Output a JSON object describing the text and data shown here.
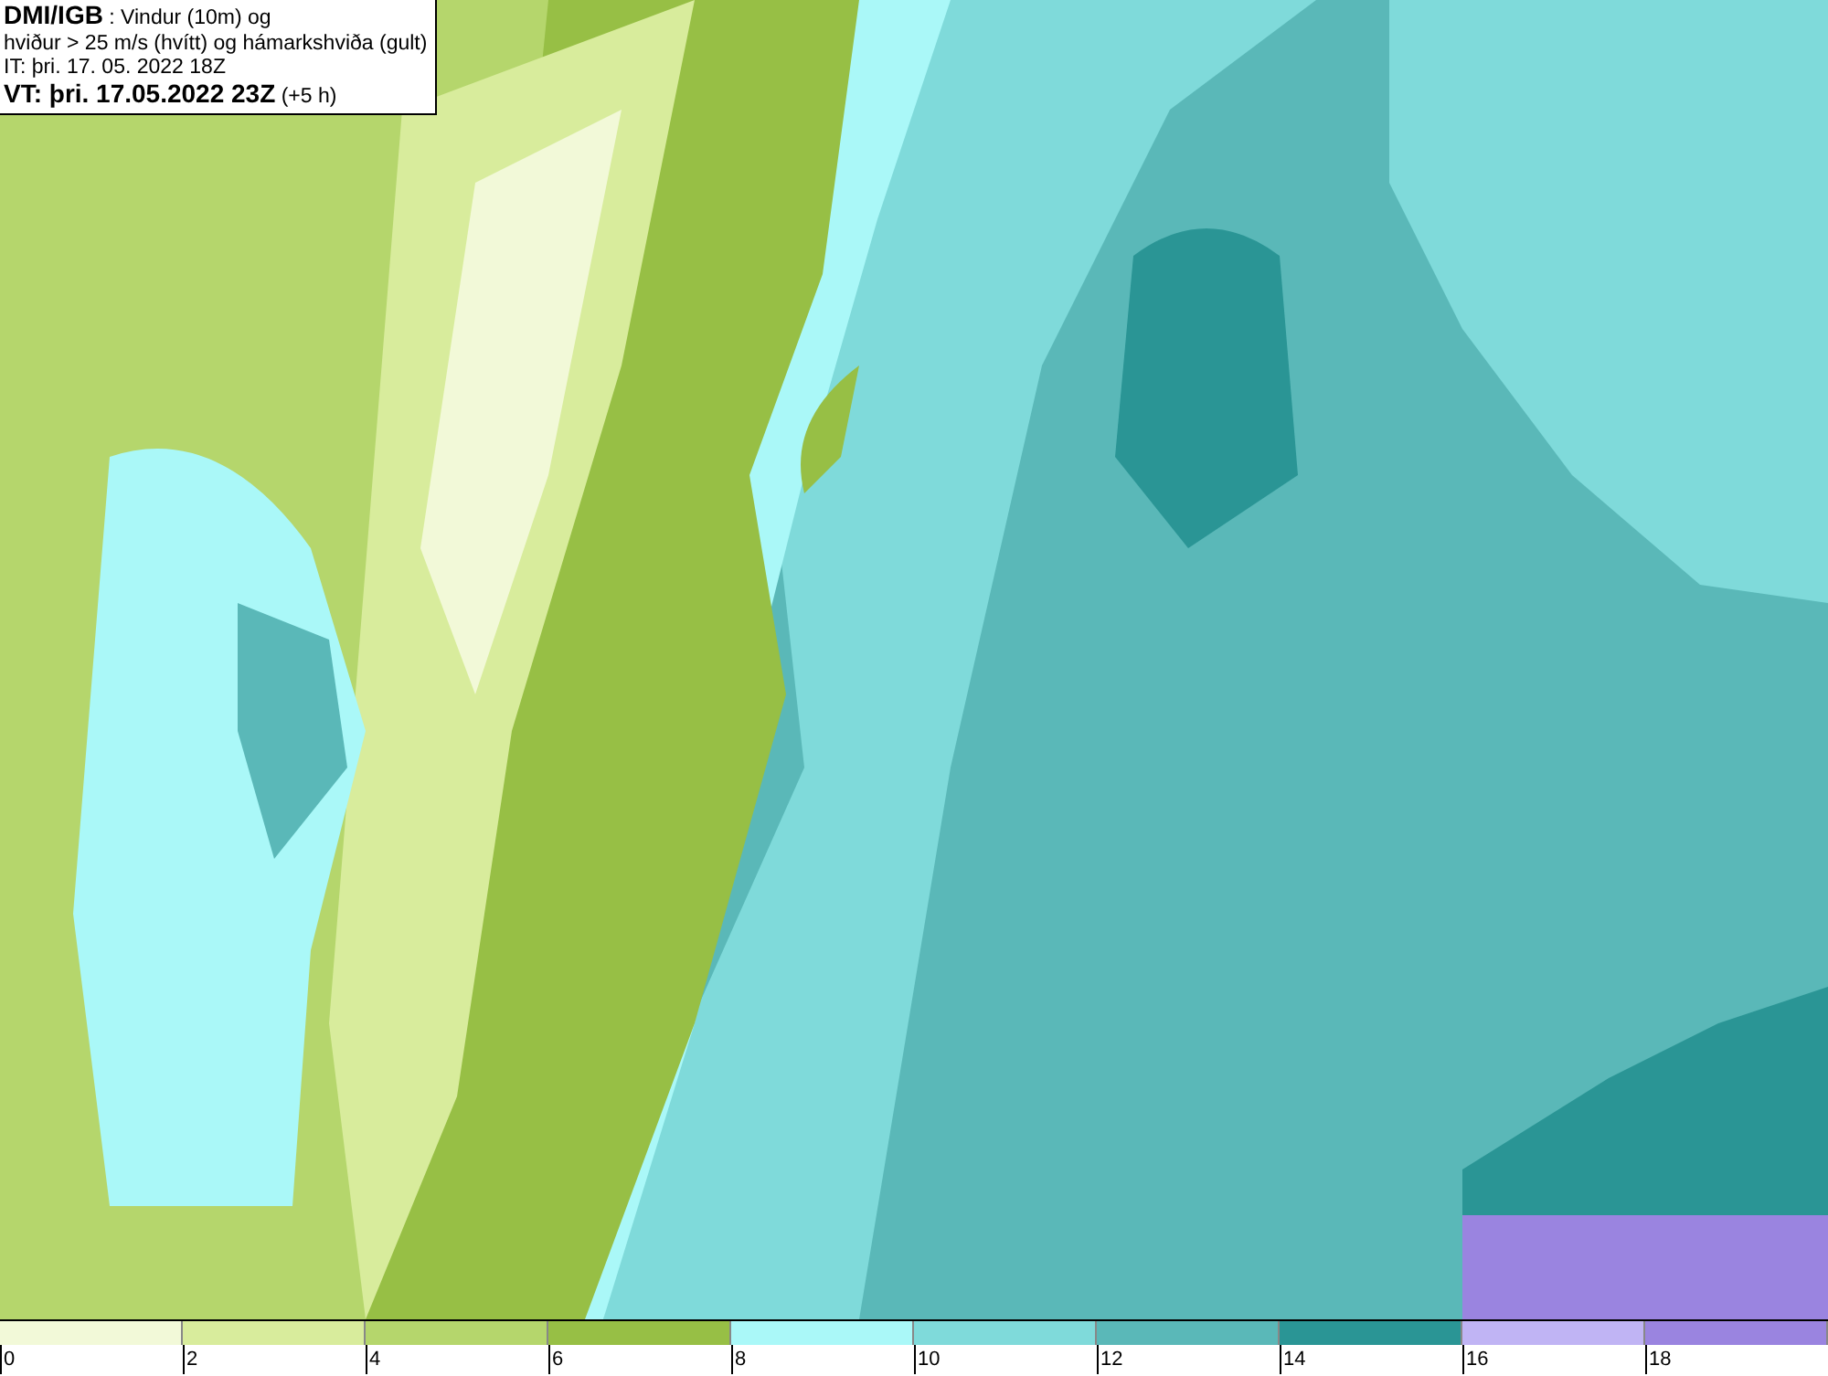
{
  "title_box": {
    "lines": [
      "**DMI/IGB** : Vindur (10m) og",
      "hviður > 25 m/s (hvítt) og hámarkshviða (gult)",
      "IT: þri. 17. 05. 2022 18Z",
      "**VT: þri. 17.05.2022 23Z** (+5 h)"
    ]
  },
  "legend": {
    "bins": [
      {
        "color": "#f2f9d8"
      },
      {
        "color": "#d8ec9c"
      },
      {
        "color": "#b5d66c"
      },
      {
        "color": "#97bf45"
      },
      {
        "color": "#aaf8f8"
      },
      {
        "color": "#7fdada"
      },
      {
        "color": "#5ab8b8"
      },
      {
        "color": "#2a9595"
      },
      {
        "color": "#c0b4f4"
      },
      {
        "color": "#9a84e0"
      }
    ],
    "ticks": [
      "0",
      "2",
      "4",
      "6",
      "8",
      "10",
      "12",
      "14",
      "16",
      "18"
    ]
  }
}
